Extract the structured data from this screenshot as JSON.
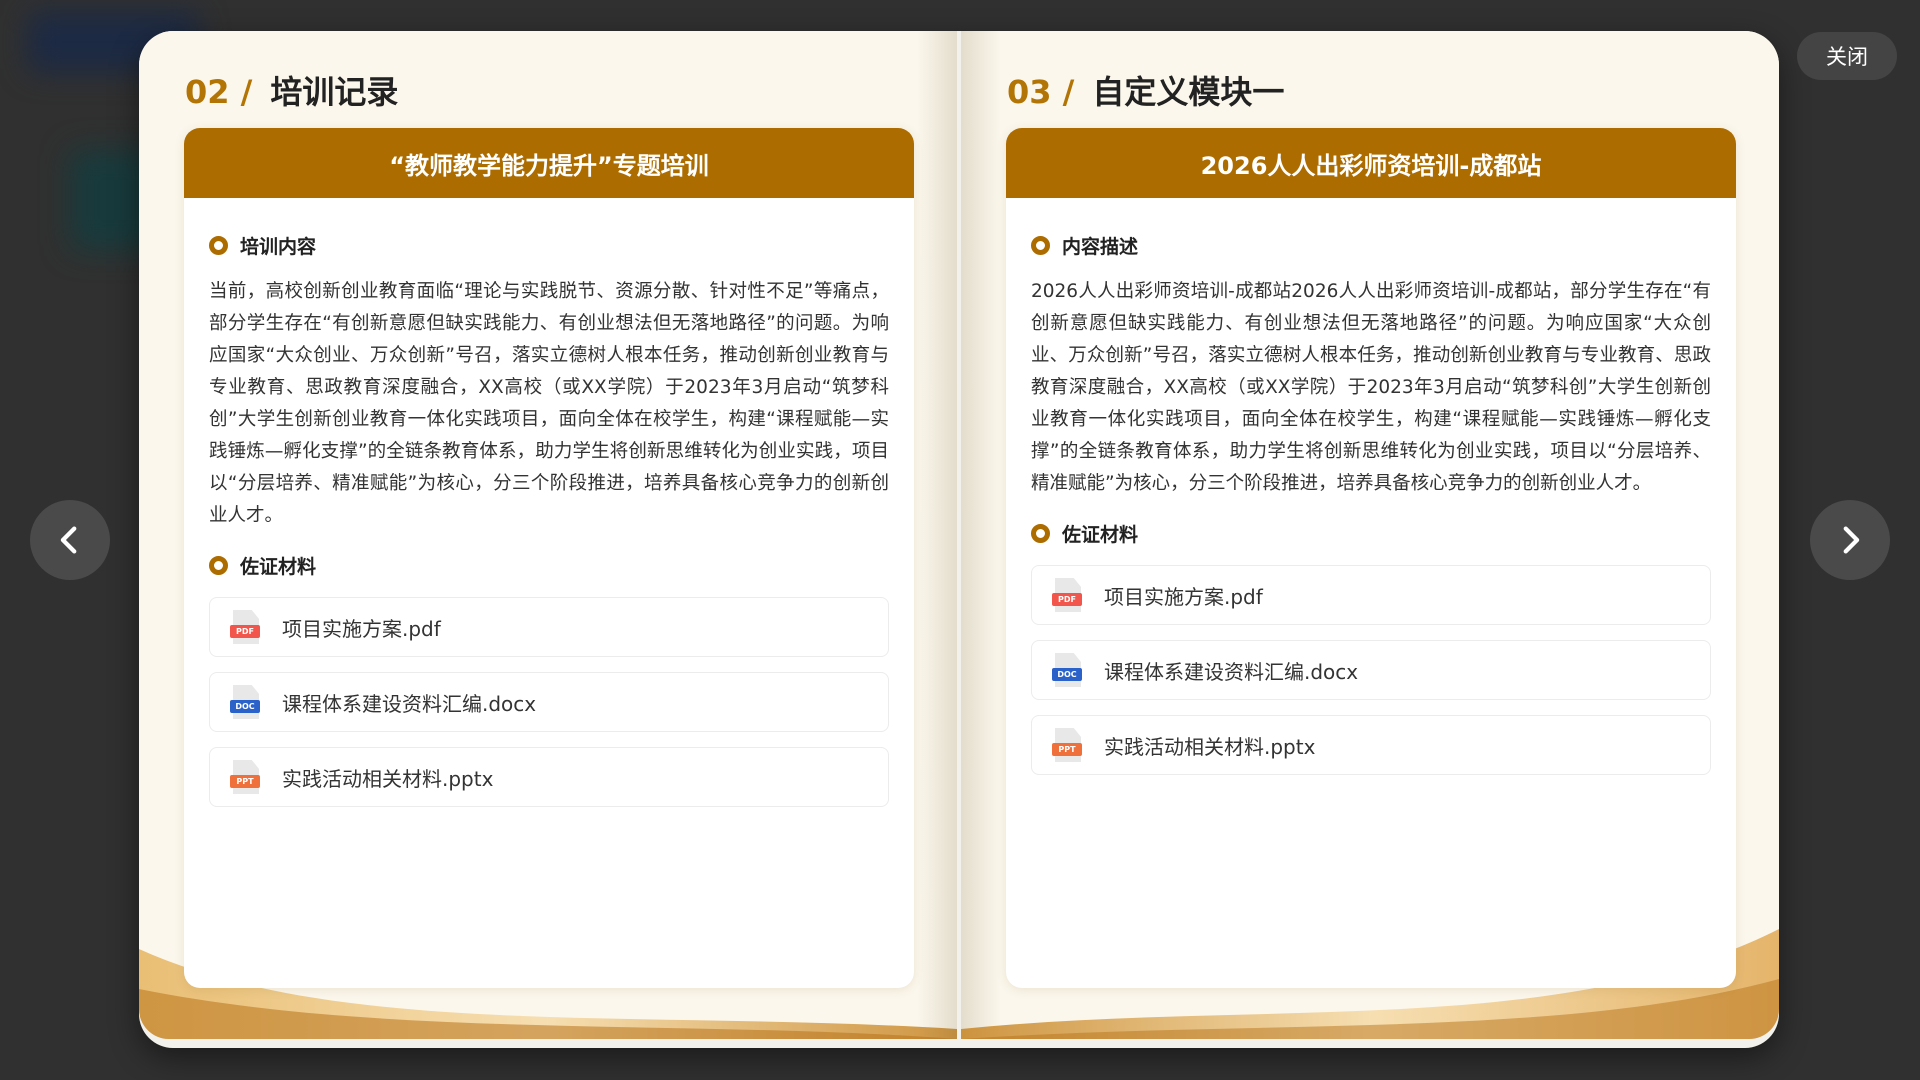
{
  "close_button": {
    "label": "关闭"
  },
  "navigation": {
    "prev_icon": "chevron-left-icon",
    "next_icon": "chevron-right-icon"
  },
  "colors": {
    "accent": "#ac6c00",
    "page_background": "#fbf7ec",
    "overlay": "#303030"
  },
  "left_page": {
    "section_number": "02 /",
    "section_title": "培训记录",
    "card_title": "“教师教学能力提升”专题培训",
    "content_heading": "培训内容",
    "content_text": "当前，高校创新创业教育面临“理论与实践脱节、资源分散、针对性不足”等痛点，部分学生存在“有创新意愿但缺实践能力、有创业想法但无落地路径”的问题。为响应国家“大众创业、万众创新”号召，落实立德树人根本任务，推动创新创业教育与专业教育、思政教育深度融合，XX高校（或XX学院）于2023年3月启动“筑梦科创”大学生创新创业教育一体化实践项目，面向全体在校学生，构建“课程赋能—实践锤炼—孵化支撑”的全链条教育体系，助力学生将创新思维转化为创业实践，项目以“分层培养、精准赋能”为核心，分三个阶段推进，培养具备核心竞争力的创新创业人才。",
    "evidence_heading": "佐证材料",
    "files": [
      {
        "name": "项目实施方案.pdf",
        "type_label": "PDF"
      },
      {
        "name": "课程体系建设资料汇编.docx",
        "type_label": "DOC"
      },
      {
        "name": "实践活动相关材料.pptx",
        "type_label": "PPT"
      }
    ]
  },
  "right_page": {
    "section_number": "03 /",
    "section_title": "自定义模块一",
    "card_title": "2026人人出彩师资培训-成都站",
    "content_heading": "内容描述",
    "content_text": "2026人人出彩师资培训-成都站2026人人出彩师资培训-成都站，部分学生存在“有创新意愿但缺实践能力、有创业想法但无落地路径”的问题。为响应国家“大众创业、万众创新”号召，落实立德树人根本任务，推动创新创业教育与专业教育、思政教育深度融合，XX高校（或XX学院）于2023年3月启动“筑梦科创”大学生创新创业教育一体化实践项目，面向全体在校学生，构建“课程赋能—实践锤炼—孵化支撑”的全链条教育体系，助力学生将创新思维转化为创业实践，项目以“分层培养、精准赋能”为核心，分三个阶段推进，培养具备核心竞争力的创新创业人才。",
    "evidence_heading": "佐证材料",
    "files": [
      {
        "name": "项目实施方案.pdf",
        "type_label": "PDF"
      },
      {
        "name": "课程体系建设资料汇编.docx",
        "type_label": "DOC"
      },
      {
        "name": "实践活动相关材料.pptx",
        "type_label": "PPT"
      }
    ]
  }
}
